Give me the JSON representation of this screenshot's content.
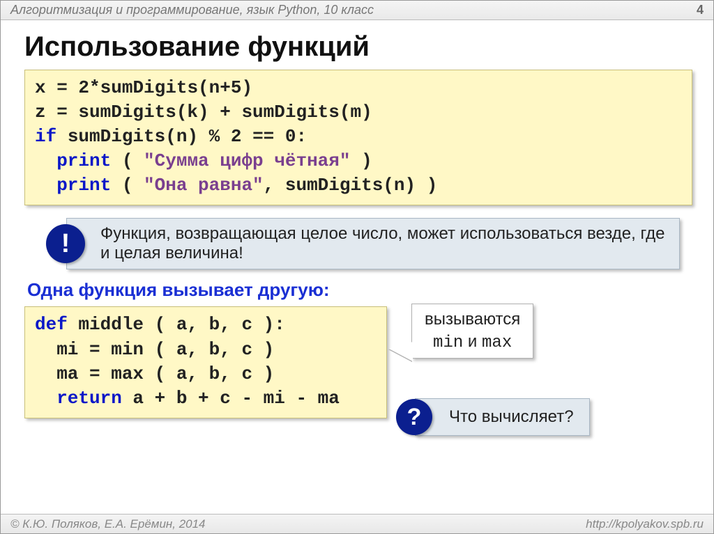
{
  "header": {
    "course": "Алгоритмизация и программирование, язык Python, 10 класс",
    "page": "4"
  },
  "title": "Использование функций",
  "code1": {
    "line1_a": "x = ",
    "line1_b": "2",
    "line1_c": "*sumDigits(n+5)",
    "line2": "z = sumDigits(k) + sumDigits(m)",
    "line3_a": "if",
    "line3_b": " sumDigits(n) % ",
    "line3_c": "2",
    "line3_d": " == ",
    "line3_e": "0",
    "line3_f": ":",
    "line4_kw": "  print",
    "line4_rest": " ( ",
    "line4_str": "\"Сумма цифр чётная\"",
    "line4_end": " )",
    "line5_kw": "  print",
    "line5_rest": " ( ",
    "line5_str": "\"Она равна\"",
    "line5_end": ", sumDigits(n) )"
  },
  "tip": {
    "badge": "!",
    "text": "Функция, возвращающая целое число, может использоваться везде, где и целая величина!"
  },
  "subheading": "Одна функция вызывает другую:",
  "code2": {
    "line1_kw": "def",
    "line1_rest": " middle ( a, b, c ):",
    "line2": "  mi = min ( a, b, c )",
    "line3": "  ma = max ( a, b, c )",
    "line4_kw": "  return",
    "line4_rest": " a + b + c - mi - ma"
  },
  "callout": {
    "line1": "вызываются",
    "min": "min",
    "and": " и ",
    "max": "max"
  },
  "question": {
    "badge": "?",
    "text": "Что вычисляет?"
  },
  "footer": {
    "authors": "© К.Ю. Поляков, Е.А. Ерёмин, 2014",
    "url": "http://kpolyakov.spb.ru"
  }
}
